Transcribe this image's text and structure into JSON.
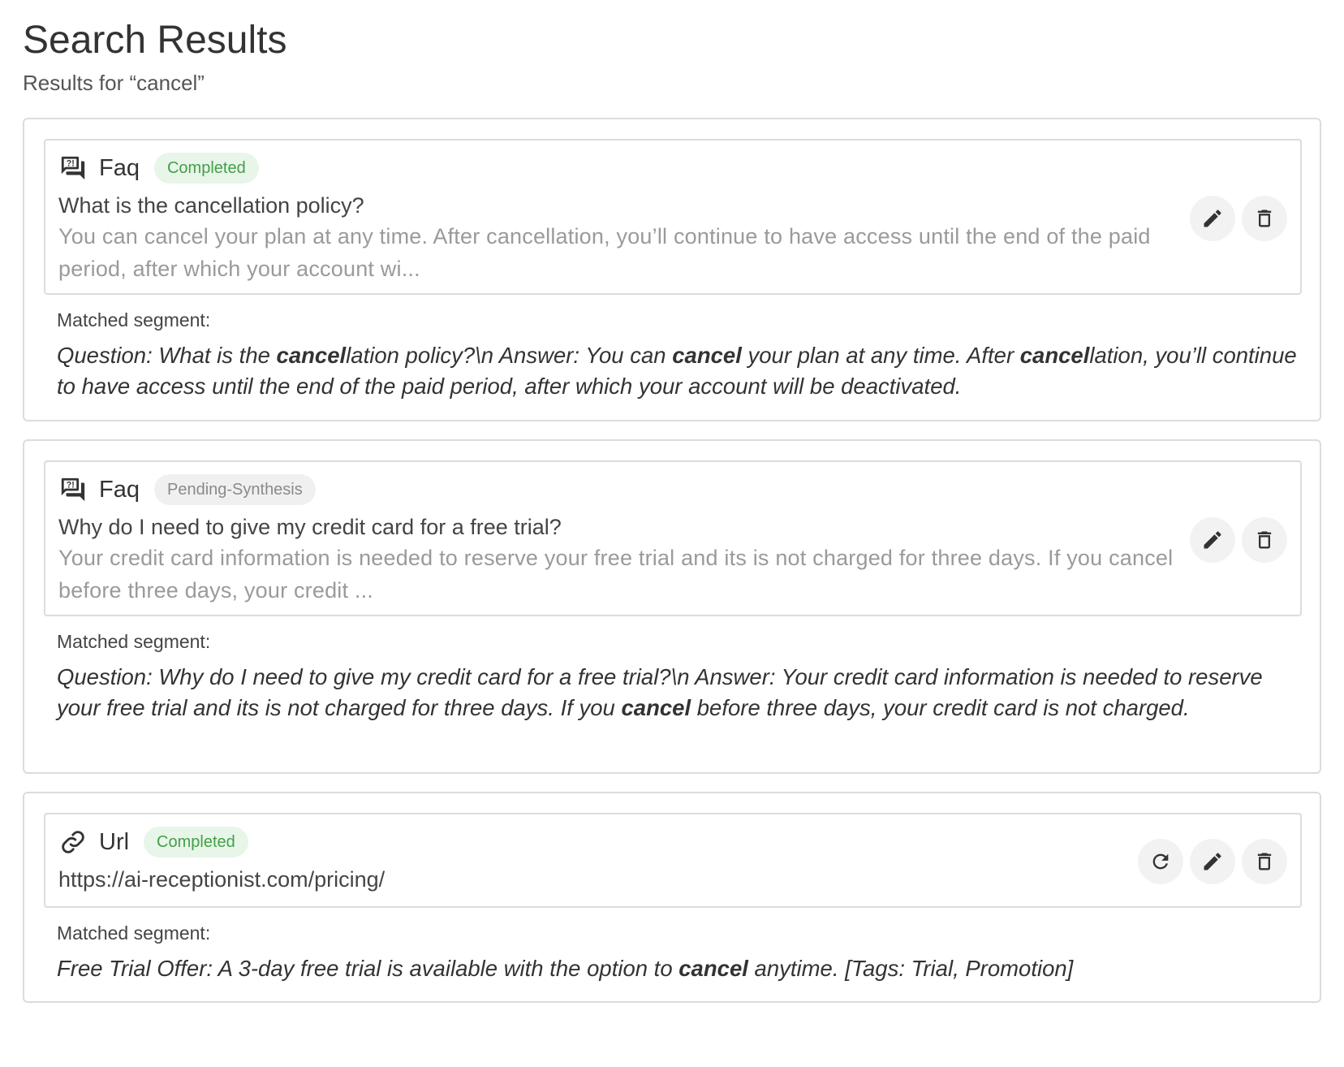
{
  "header": {
    "title": "Search Results",
    "subtitle": "Results for “cancel”"
  },
  "icons": {
    "faq": "quiz-chat-icon",
    "url": "link-icon",
    "edit": "pencil-icon",
    "delete": "trash-icon",
    "refresh": "refresh-icon"
  },
  "colors": {
    "badge_completed_bg": "#e8f5e9",
    "badge_completed_text": "#43a047",
    "badge_pending_bg": "#f0f0f0",
    "badge_pending_text": "#8a8a8a"
  },
  "results": [
    {
      "type": "Faq",
      "status": "Completed",
      "title": "What is the cancellation policy?",
      "preview": "You can cancel your plan at any time. After cancellation, you’ll continue to have access until the end of the paid period, after which your account wi...",
      "matched_label": "Matched segment:",
      "matched_parts": [
        {
          "t": "Question: What is the ",
          "b": false
        },
        {
          "t": "cancel",
          "b": true
        },
        {
          "t": "lation policy?\\n Answer: You can ",
          "b": false
        },
        {
          "t": "cancel",
          "b": true
        },
        {
          "t": " your plan at any time. After ",
          "b": false
        },
        {
          "t": "cancel",
          "b": true
        },
        {
          "t": "lation, you’ll continue to have access until the end of the paid period, after which your account will be deactivated.",
          "b": false
        }
      ]
    },
    {
      "type": "Faq",
      "status": "Pending-Synthesis",
      "title": "Why do I need to give my credit card for a free trial?",
      "preview": "Your credit card information is needed to reserve your free trial and its is not charged for three days. If you cancel before three days, your credit ...",
      "matched_label": "Matched segment:",
      "matched_parts": [
        {
          "t": "Question: Why do I need to give my credit card for a free trial?\\n Answer: Your credit card information is needed to reserve your free trial and its is not charged for three days. If you ",
          "b": false
        },
        {
          "t": "cancel",
          "b": true
        },
        {
          "t": " before three days, your credit card is not charged.",
          "b": false
        }
      ]
    },
    {
      "type": "Url",
      "status": "Completed",
      "title": "https://ai-receptionist.com/pricing/",
      "matched_label": "Matched segment:",
      "matched_parts": [
        {
          "t": "Free Trial Offer: A 3-day free trial is available with the option to ",
          "b": false
        },
        {
          "t": "cancel",
          "b": true
        },
        {
          "t": " anytime. [Tags: Trial, Promotion]",
          "b": false
        }
      ]
    }
  ]
}
